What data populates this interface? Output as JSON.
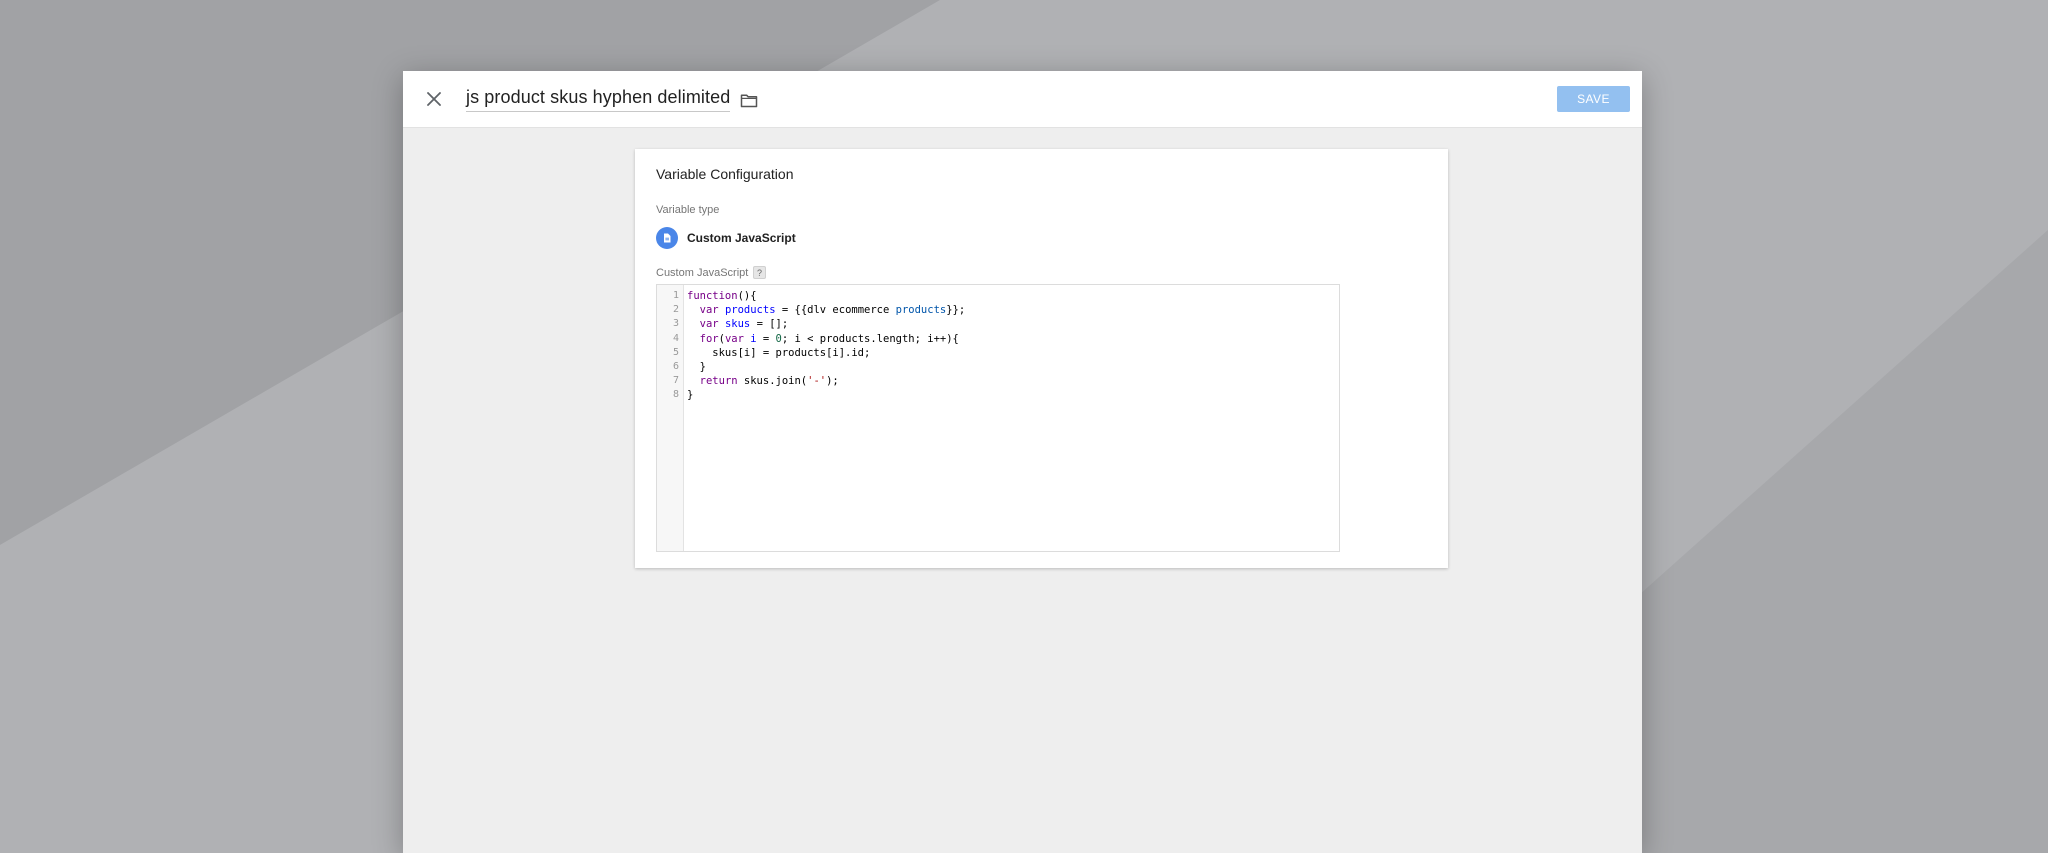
{
  "modal": {
    "title": "js product skus hyphen delimited",
    "save_label": "SAVE"
  },
  "card": {
    "title": "Variable Configuration",
    "variable_type_label": "Variable type",
    "variable_type_value": "Custom JavaScript",
    "code_label": "Custom JavaScript",
    "help_label": "?"
  },
  "editor": {
    "line_numbers": [
      "1",
      "2",
      "3",
      "4",
      "5",
      "6",
      "7",
      "8"
    ],
    "lines": [
      "function(){",
      "  var products = {{dlv ecommerce products}};",
      "  var skus = [];",
      "  for(var i = 0; i < products.length; i++){",
      "    skus[i] = products[i].id;",
      "  }",
      "  return skus.join('-');",
      "}"
    ]
  },
  "icons": {
    "close": "close-icon",
    "folder": "folder-icon",
    "variable_type": "document-code-icon",
    "help": "help-icon"
  },
  "colors": {
    "save_button": "#93c0f0",
    "type_icon": "#4a86e8"
  }
}
